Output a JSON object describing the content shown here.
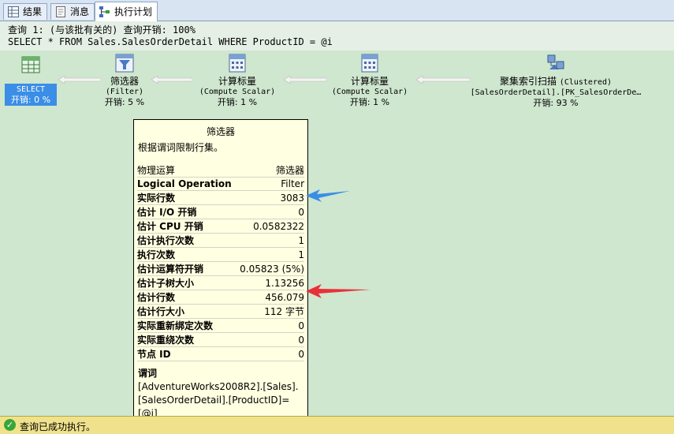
{
  "tabs": [
    {
      "label": "结果",
      "icon": "grid-icon"
    },
    {
      "label": "消息",
      "icon": "messages-icon"
    },
    {
      "label": "执行计划",
      "icon": "plan-icon"
    }
  ],
  "query": {
    "line1": "查询 1: (与该批有关的) 查询开销: 100%",
    "line2": "SELECT * FROM Sales.SalesOrderDetail WHERE ProductID = @i"
  },
  "nodes": [
    {
      "name": "SELECT",
      "cost": "开销: 0 %"
    },
    {
      "name": "筛选器",
      "sub": "(Filter)",
      "cost": "开销: 5 %"
    },
    {
      "name": "计算标量",
      "sub": "(Compute Scalar)",
      "cost": "开销: 1 %"
    },
    {
      "name": "计算标量",
      "sub": "(Compute Scalar)",
      "cost": "开销: 1 %"
    },
    {
      "name": "聚集索引扫描",
      "name_suffix": "(Clustered)",
      "sub": "[SalesOrderDetail].[PK_SalesOrderDe…",
      "cost": "开销: 93 %"
    }
  ],
  "tooltip": {
    "title": "筛选器",
    "description": "根据谓词限制行集。",
    "rows": [
      {
        "label": "物理运算",
        "value": "筛选器"
      },
      {
        "label": "Logical Operation",
        "value": "Filter"
      },
      {
        "label": "实际行数",
        "value": "3083"
      },
      {
        "label": "估计 I/O 开销",
        "value": "0"
      },
      {
        "label": "估计 CPU 开销",
        "value": "0.0582322"
      },
      {
        "label": "估计执行次数",
        "value": "1"
      },
      {
        "label": "执行次数",
        "value": "1"
      },
      {
        "label": "估计运算符开销",
        "value": "0.05823 (5%)"
      },
      {
        "label": "估计子树大小",
        "value": "1.13256"
      },
      {
        "label": "估计行数",
        "value": "456.079"
      },
      {
        "label": "估计行大小",
        "value": "112 字节"
      },
      {
        "label": "实际重新绑定次数",
        "value": "0"
      },
      {
        "label": "实际重绕次数",
        "value": "0"
      },
      {
        "label": "节点 ID",
        "value": "0"
      }
    ],
    "predicate_title": "谓词",
    "predicate": "[AdventureWorks2008R2].[Sales].[SalesOrderDetail].[ProductID]=[@i]"
  },
  "status": {
    "text": "查询已成功执行。",
    "color": "#f0e28c"
  },
  "annotations": {
    "blue_arrow_color": "#3a8ee6",
    "red_arrow_color": "#e8303a"
  }
}
